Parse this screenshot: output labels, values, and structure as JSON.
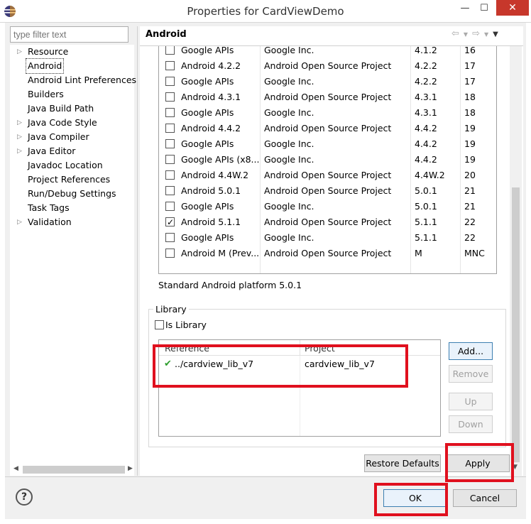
{
  "window": {
    "title": "Properties for CardViewDemo",
    "minimize_glyph": "—",
    "maximize_glyph": "☐",
    "close_glyph": "✕"
  },
  "filter": {
    "placeholder": "type filter text"
  },
  "tree": {
    "items": [
      {
        "label": "Resource",
        "expandable": true
      },
      {
        "label": "Android",
        "expandable": false,
        "selected": true
      },
      {
        "label": "Android Lint Preferences",
        "expandable": false
      },
      {
        "label": "Builders",
        "expandable": false
      },
      {
        "label": "Java Build Path",
        "expandable": false
      },
      {
        "label": "Java Code Style",
        "expandable": true
      },
      {
        "label": "Java Compiler",
        "expandable": true
      },
      {
        "label": "Java Editor",
        "expandable": true
      },
      {
        "label": "Javadoc Location",
        "expandable": false
      },
      {
        "label": "Project References",
        "expandable": false
      },
      {
        "label": "Run/Debug Settings",
        "expandable": false
      },
      {
        "label": "Task Tags",
        "expandable": false
      },
      {
        "label": "Validation",
        "expandable": true
      }
    ]
  },
  "page": {
    "title": "Android"
  },
  "targets": {
    "rows": [
      {
        "name": "Google APIs",
        "vendor": "Google Inc.",
        "platform": "4.1.2",
        "api": "16",
        "checked": false
      },
      {
        "name": "Android 4.2.2",
        "vendor": "Android Open Source Project",
        "platform": "4.2.2",
        "api": "17",
        "checked": false
      },
      {
        "name": "Google APIs",
        "vendor": "Google Inc.",
        "platform": "4.2.2",
        "api": "17",
        "checked": false
      },
      {
        "name": "Android 4.3.1",
        "vendor": "Android Open Source Project",
        "platform": "4.3.1",
        "api": "18",
        "checked": false
      },
      {
        "name": "Google APIs",
        "vendor": "Google Inc.",
        "platform": "4.3.1",
        "api": "18",
        "checked": false
      },
      {
        "name": "Android 4.4.2",
        "vendor": "Android Open Source Project",
        "platform": "4.4.2",
        "api": "19",
        "checked": false
      },
      {
        "name": "Google APIs",
        "vendor": "Google Inc.",
        "platform": "4.4.2",
        "api": "19",
        "checked": false
      },
      {
        "name": "Google APIs (x8...",
        "vendor": "Google Inc.",
        "platform": "4.4.2",
        "api": "19",
        "checked": false
      },
      {
        "name": "Android 4.4W.2",
        "vendor": "Android Open Source Project",
        "platform": "4.4W.2",
        "api": "20",
        "checked": false
      },
      {
        "name": "Android 5.0.1",
        "vendor": "Android Open Source Project",
        "platform": "5.0.1",
        "api": "21",
        "checked": false
      },
      {
        "name": "Google APIs",
        "vendor": "Google Inc.",
        "platform": "5.0.1",
        "api": "21",
        "checked": false
      },
      {
        "name": "Android 5.1.1",
        "vendor": "Android Open Source Project",
        "platform": "5.1.1",
        "api": "22",
        "checked": true
      },
      {
        "name": "Google APIs",
        "vendor": "Google Inc.",
        "platform": "5.1.1",
        "api": "22",
        "checked": false
      },
      {
        "name": "Android M (Prev...",
        "vendor": "Android Open Source Project",
        "platform": "M",
        "api": "MNC",
        "checked": false
      }
    ],
    "description": "Standard Android platform 5.0.1"
  },
  "library": {
    "group_label": "Library",
    "is_library_label": "Is Library",
    "is_library_checked": false,
    "columns": {
      "reference": "Reference",
      "project": "Project"
    },
    "rows": [
      {
        "reference": "../cardview_lib_v7",
        "project": "cardview_lib_v7",
        "status_icon": "check-icon"
      }
    ],
    "buttons": {
      "add": "Add...",
      "remove": "Remove",
      "up": "Up",
      "down": "Down"
    }
  },
  "footer": {
    "restore_defaults": "Restore Defaults",
    "apply": "Apply",
    "ok": "OK",
    "cancel": "Cancel",
    "help_glyph": "?"
  },
  "highlight_color": "#e0101e",
  "accent_colors": {
    "title_close": "#c7372b",
    "check_green": "#2e9e2e"
  }
}
